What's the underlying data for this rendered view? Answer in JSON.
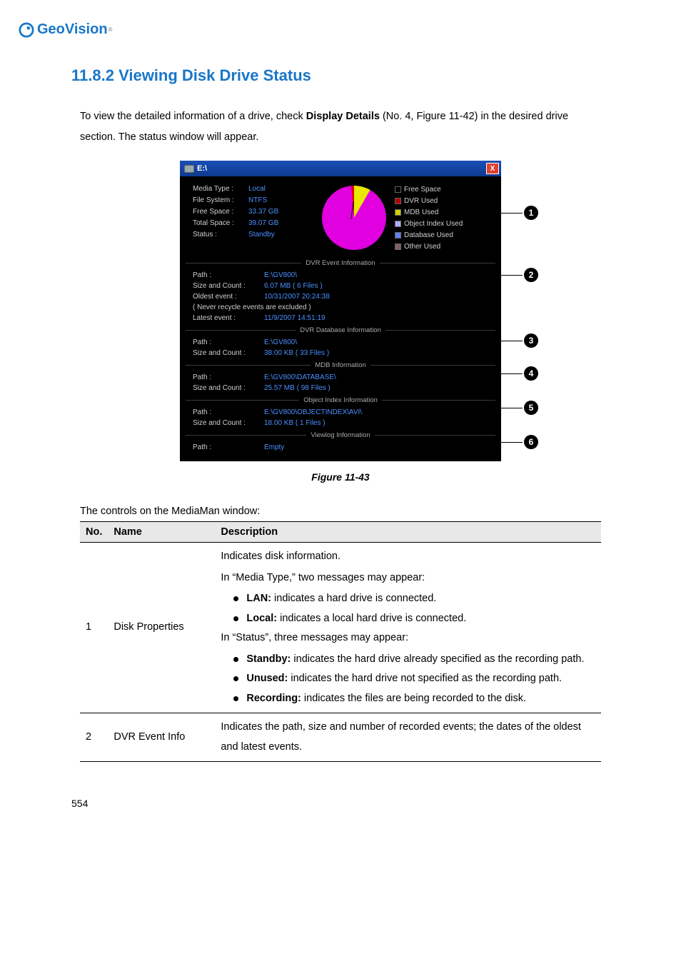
{
  "logo": {
    "brand": "GeoVision"
  },
  "section": {
    "title": "11.8.2  Viewing Disk Drive Status",
    "intro_1": "To view the detailed information of a drive, check ",
    "intro_bold": "Display Details",
    "intro_2": " (No. 4, Figure 11-42) in the desired drive section. The status window will appear."
  },
  "window": {
    "title": "E:\\",
    "close": "X",
    "props": {
      "labels": {
        "media_type": "Media Type :",
        "file_system": "File System :",
        "free_space": "Free Space :",
        "total_space": "Total Space :",
        "status": "Status :"
      },
      "values": {
        "media_type": "Local",
        "file_system": "NTFS",
        "free_space": "33.37 GB",
        "total_space": "39.07 GB",
        "status": "Standby"
      }
    },
    "legend": {
      "free_space": "Free Space",
      "dvr_used": "DVR Used",
      "mdb_used": "MDB Used",
      "obj_used": "Object Index Used",
      "db_used": "Database Used",
      "other_used": "Other Used",
      "colors": {
        "free_space": "#e0e000",
        "dvr_used": "#b00000",
        "mdb_used": "#d0d000",
        "obj_used": "#b0b0ff",
        "db_used": "#6080ff",
        "other_used": "#806060"
      }
    },
    "groups": {
      "dvr_event": {
        "label": "DVR Event Information",
        "path_k": "Path :",
        "path_v": "E:\\GV800\\",
        "size_k": "Size and Count :",
        "size_v": "6.07 MB ( 6 Files )",
        "oldest_k": "Oldest event :",
        "oldest_v": "10/31/2007 20:24:38",
        "note": "( Never recycle events are excluded )",
        "latest_k": "Latest event :",
        "latest_v": "11/9/2007 14:51:19"
      },
      "dvr_db": {
        "label": "DVR Database Information",
        "path_k": "Path :",
        "path_v": "E:\\GV800\\",
        "size_k": "Size and Count :",
        "size_v": "38.00 KB ( 33 Files )"
      },
      "mdb": {
        "label": "MDB Information",
        "path_k": "Path :",
        "path_v": "E:\\GV800\\DATABASE\\",
        "size_k": "Size and Count :",
        "size_v": "25.57 MB ( 98 Files )"
      },
      "obj": {
        "label": "Object Index Information",
        "path_k": "Path :",
        "path_v": "E:\\GV800\\OBJECTINDEX\\AVI\\",
        "size_k": "Size and Count :",
        "size_v": "18.00 KB ( 1 Files )"
      },
      "viewlog": {
        "label": "Viewlog Information",
        "path_k": "Path :",
        "path_v": "Empty"
      }
    }
  },
  "callouts": {
    "1": "1",
    "2": "2",
    "3": "3",
    "4": "4",
    "5": "5",
    "6": "6"
  },
  "figure_caption": "Figure 11-43",
  "controls_intro": "The controls on the MediaMan window:",
  "table": {
    "h_no": "No.",
    "h_name": "Name",
    "h_desc": "Description",
    "rows": [
      {
        "no": "1",
        "name": "Disk Properties",
        "desc_line1": "Indicates disk information.",
        "desc_line2": "In “Media Type,” two messages may appear:",
        "bullet1_b": "LAN:",
        "bullet1_t": " indicates a hard drive is connected.",
        "bullet2_b": "Local:",
        "bullet2_t": " indicates a local hard drive is connected.",
        "desc_line3": "In “Status”, three messages may appear:",
        "bullet3_b": "Standby:",
        "bullet3_t": " indicates the hard drive already specified as the recording path.",
        "bullet4_b": "Unused:",
        "bullet4_t": " indicates the hard drive not specified as the recording path.",
        "bullet5_b": "Recording:",
        "bullet5_t": " indicates the files are being recorded to the disk."
      },
      {
        "no": "2",
        "name": "DVR Event Info",
        "desc": "Indicates the path, size and number of recorded events; the dates of the oldest and latest events."
      }
    ]
  },
  "page_number": "554"
}
